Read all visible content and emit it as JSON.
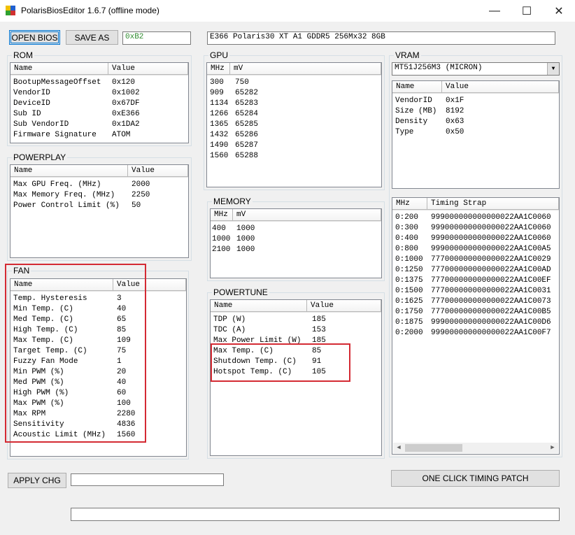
{
  "window": {
    "title": "PolarisBiosEditor 1.6.7 (offline mode)"
  },
  "toolbar": {
    "open_label": "OPEN BIOS",
    "saveas_label": "SAVE AS",
    "checksum": "0xB2",
    "bios_name": "E366 Polaris30 XT A1 GDDR5 256Mx32 8GB"
  },
  "rom": {
    "title": "ROM",
    "headers": [
      "Name",
      "Value"
    ],
    "rows": [
      [
        "BootupMessageOffset",
        "0x120"
      ],
      [
        "VendorID",
        "0x1002"
      ],
      [
        "DeviceID",
        "0x67DF"
      ],
      [
        "Sub ID",
        "0xE366"
      ],
      [
        "Sub VendorID",
        "0x1DA2"
      ],
      [
        "Firmware Signature",
        "ATOM"
      ]
    ]
  },
  "powerplay": {
    "title": "POWERPLAY",
    "headers": [
      "Name",
      "Value"
    ],
    "rows": [
      [
        "Max GPU Freq. (MHz)",
        "2000"
      ],
      [
        "Max Memory Freq. (MHz)",
        "2250"
      ],
      [
        "Power Control Limit (%)",
        "50"
      ]
    ]
  },
  "fan": {
    "title": "FAN",
    "headers": [
      "Name",
      "Value"
    ],
    "rows": [
      [
        "Temp. Hysteresis",
        "3"
      ],
      [
        "Min Temp. (C)",
        "40"
      ],
      [
        "Med Temp. (C)",
        "65"
      ],
      [
        "High Temp. (C)",
        "85"
      ],
      [
        "Max Temp. (C)",
        "109"
      ],
      [
        "Target Temp. (C)",
        "75"
      ],
      [
        "Fuzzy Fan Mode",
        "1"
      ],
      [
        "Min PWM (%)",
        "20"
      ],
      [
        "Med PWM (%)",
        "40"
      ],
      [
        "High PWM (%)",
        "60"
      ],
      [
        "Max PWM (%)",
        "100"
      ],
      [
        "Max RPM",
        "2280"
      ],
      [
        "Sensitivity",
        "4836"
      ],
      [
        "Acoustic Limit (MHz)",
        "1560"
      ]
    ]
  },
  "gpu": {
    "title": "GPU",
    "headers": [
      "MHz",
      "mV"
    ],
    "rows": [
      [
        "300",
        "750"
      ],
      [
        "909",
        "65282"
      ],
      [
        "1134",
        "65283"
      ],
      [
        "1266",
        "65284"
      ],
      [
        "1365",
        "65285"
      ],
      [
        "1432",
        "65286"
      ],
      [
        "1490",
        "65287"
      ],
      [
        "1560",
        "65288"
      ]
    ]
  },
  "memory": {
    "title": "MEMORY",
    "headers": [
      "MHz",
      "mV"
    ],
    "rows": [
      [
        "400",
        "1000"
      ],
      [
        "1000",
        "1000"
      ],
      [
        "2100",
        "1000"
      ]
    ]
  },
  "powertune": {
    "title": "POWERTUNE",
    "headers": [
      "Name",
      "Value"
    ],
    "rows": [
      [
        "TDP (W)",
        "185"
      ],
      [
        "TDC (A)",
        "153"
      ],
      [
        "Max Power Limit (W)",
        "185"
      ],
      [
        "Max Temp. (C)",
        "85"
      ],
      [
        "Shutdown Temp. (C)",
        "91"
      ],
      [
        "Hotspot Temp. (C)",
        "105"
      ]
    ]
  },
  "vram": {
    "title": "VRAM",
    "selected": "MT51J256M3 (MICRON)",
    "headers": [
      "Name",
      "Value"
    ],
    "rows": [
      [
        "VendorID",
        "0x1F"
      ],
      [
        "Size (MB)",
        "8192"
      ],
      [
        "Density",
        "0x63"
      ],
      [
        "Type",
        "0x50"
      ]
    ]
  },
  "timing": {
    "headers": [
      "MHz",
      "Timing Strap"
    ],
    "rows": [
      [
        "0:200",
        "999000000000000022AA1C0060"
      ],
      [
        "0:300",
        "999000000000000022AA1C0060"
      ],
      [
        "0:400",
        "999000000000000022AA1C0060"
      ],
      [
        "0:800",
        "999000000000000022AA1C00A5"
      ],
      [
        "0:1000",
        "777000000000000022AA1C0029"
      ],
      [
        "0:1250",
        "777000000000000022AA1C00AD"
      ],
      [
        "0:1375",
        "777000000000000022AA1C00EF"
      ],
      [
        "0:1500",
        "777000000000000022AA1C0031"
      ],
      [
        "0:1625",
        "777000000000000022AA1C0073"
      ],
      [
        "0:1750",
        "777000000000000022AA1C00B5"
      ],
      [
        "0:1875",
        "999000000000000022AA1C00D6"
      ],
      [
        "0:2000",
        "999000000000000022AA1C00F7"
      ]
    ]
  },
  "bottom": {
    "apply_label": "APPLY CHG",
    "timing_patch_label": "ONE CLICK TIMING PATCH"
  },
  "colors": {
    "highlight": "#d42a33",
    "checksum_text": "#2e8b2e"
  }
}
